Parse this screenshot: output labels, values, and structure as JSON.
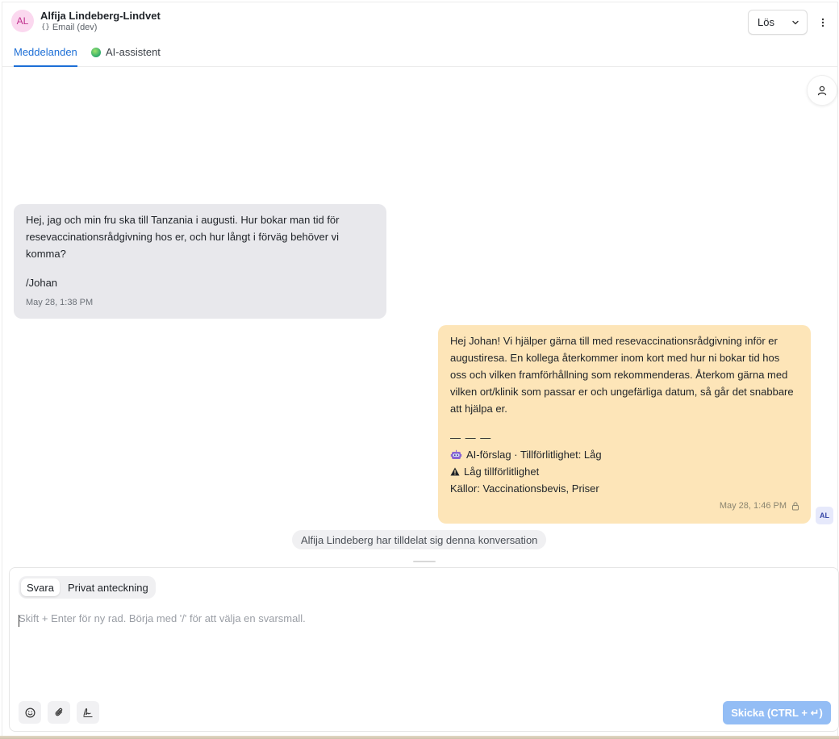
{
  "header": {
    "avatar_initials": "AL",
    "contact_name": "Alfija Lindeberg-Lindvet",
    "inbox_icon": "braces-icon",
    "inbox_label": "Email (dev)",
    "resolve_label": "Lös",
    "tabs": [
      {
        "label": "Meddelanden",
        "active": true
      },
      {
        "label": "AI-assistent",
        "active": false
      }
    ]
  },
  "messages": {
    "incoming": {
      "paragraph": "Hej, jag och min fru ska till Tanzania i augusti. Hur bokar man tid för resevaccinationsrådgivning hos er, och hur långt i förväg behöver vi komma?",
      "signature": "/Johan",
      "time": "May 28, 1:38 PM"
    },
    "outgoing": {
      "paragraph": "Hej Johan! Vi hjälper gärna till med resevaccinationsrådgivning inför er augustiresa. En kollega återkommer inom kort med hur ni bokar tid hos oss och vilken framförhållning som rekommenderas. Återkom gärna med vilken ort/klinik som passar er och ungefärliga datum, så går det snabbare att hjälpa er.",
      "separator": "— — —",
      "ai_line": "AI-förslag · Tillförlitlighet: Låg",
      "warning_line": "Låg tillförlitlighet",
      "sources_line": "Källor: Vaccinationsbevis, Priser",
      "time": "May 28, 1:46 PM",
      "sender_initials": "AL"
    },
    "activity": "Alfija Lindeberg har tilldelat sig denna konversation"
  },
  "composer": {
    "modes": [
      {
        "label": "Svara",
        "active": true
      },
      {
        "label": "Privat anteckning",
        "active": false
      }
    ],
    "placeholder": "Skift + Enter för ny rad. Börja med '/' för att välja en svarsmall.",
    "value": "",
    "tools": [
      "emoji-icon",
      "paperclip-icon",
      "signature-icon"
    ],
    "send_label": "Skicka (CTRL + ↵)"
  },
  "colors": {
    "accent": "#1d6fd6",
    "incoming_bubble": "#e8e8ec",
    "outgoing_bubble": "#fde5b8",
    "send_button": "#93bdf5",
    "avatar_bg": "#fbd8ef"
  }
}
